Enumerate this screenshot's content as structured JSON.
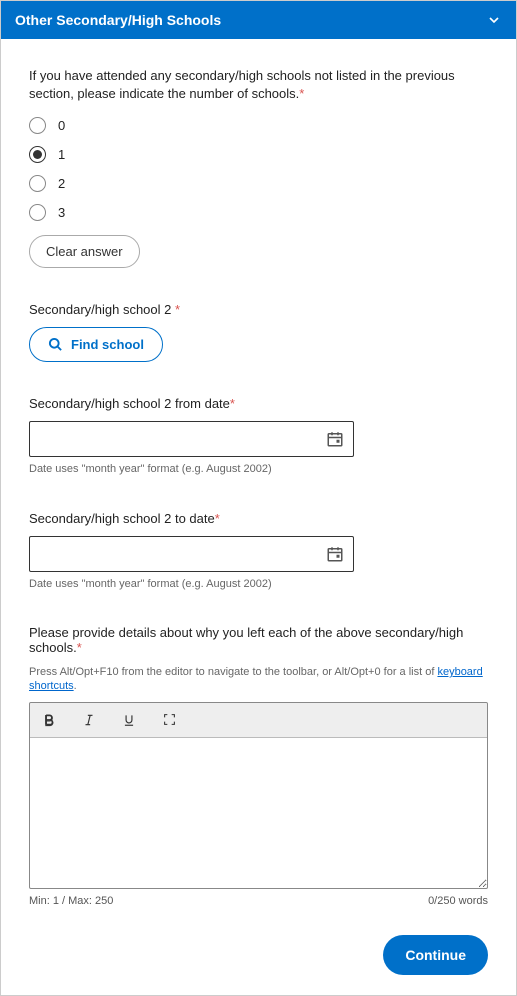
{
  "header": {
    "title": "Other Secondary/High Schools"
  },
  "intro": {
    "text": "If you have attended any secondary/high schools not listed in the previous section, please indicate the number of schools."
  },
  "radio": {
    "opt0": "0",
    "opt1": "1",
    "opt2": "2",
    "opt3": "3",
    "clear": "Clear answer"
  },
  "school2": {
    "label": "Secondary/high school 2 ",
    "find_label": "Find school"
  },
  "from_date": {
    "label": "Secondary/high school 2 from date",
    "value": "",
    "helper": "Date uses \"month year\" format (e.g. August 2002)"
  },
  "to_date": {
    "label": "Secondary/high school 2 to date",
    "value": "",
    "helper": "Date uses \"month year\" format (e.g. August 2002)"
  },
  "details": {
    "label": "Please provide details about why you left each of the above secondary/high schools.",
    "helper_pre": "Press Alt/Opt+F10 from the editor to navigate to the toolbar, or Alt/Opt+0 for a list of ",
    "helper_link": "keyboard shortcuts",
    "helper_post": ".",
    "min_max": "Min: 1 / Max: 250",
    "word_count": "0/250 words"
  },
  "continue": {
    "label": "Continue"
  }
}
